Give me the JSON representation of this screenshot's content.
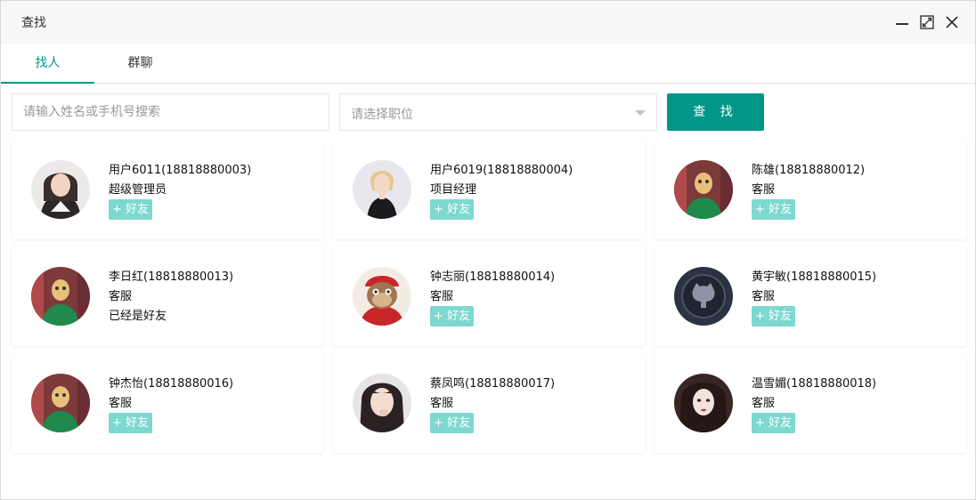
{
  "window": {
    "title": "查找"
  },
  "tabs": [
    {
      "label": "找人"
    },
    {
      "label": "群聊"
    }
  ],
  "search": {
    "input_placeholder": "请输入姓名或手机号搜索",
    "select_placeholder": "请选择职位",
    "button_label": "查 找"
  },
  "accent_color": "#009688",
  "users": [
    {
      "name": "用户6011(18818880003)",
      "role": "超级管理员",
      "action": "+ 好友",
      "avatar": "woman-portrait"
    },
    {
      "name": "用户6019(18818880004)",
      "role": "项目经理",
      "action": "+ 好友",
      "avatar": "woman-blonde"
    },
    {
      "name": "陈雄(18818880012)",
      "role": "客服",
      "action": "+ 好友",
      "avatar": "green-mask"
    },
    {
      "name": "李日红(18818880013)",
      "role": "客服",
      "status": "已经是好友",
      "avatar": "green-mask"
    },
    {
      "name": "钟志丽(18818880014)",
      "role": "客服",
      "action": "+ 好友",
      "avatar": "cartoon-monkey"
    },
    {
      "name": "黄宇敏(18818880015)",
      "role": "客服",
      "action": "+ 好友",
      "avatar": "github-octocat"
    },
    {
      "name": "钟杰怡(18818880016)",
      "role": "客服",
      "action": "+ 好友",
      "avatar": "green-mask"
    },
    {
      "name": "蔡凤鸣(18818880017)",
      "role": "客服",
      "action": "+ 好友",
      "avatar": "girl-selfie"
    },
    {
      "name": "温雪媚(18818880018)",
      "role": "客服",
      "action": "+ 好友",
      "avatar": "woman-dark"
    }
  ]
}
